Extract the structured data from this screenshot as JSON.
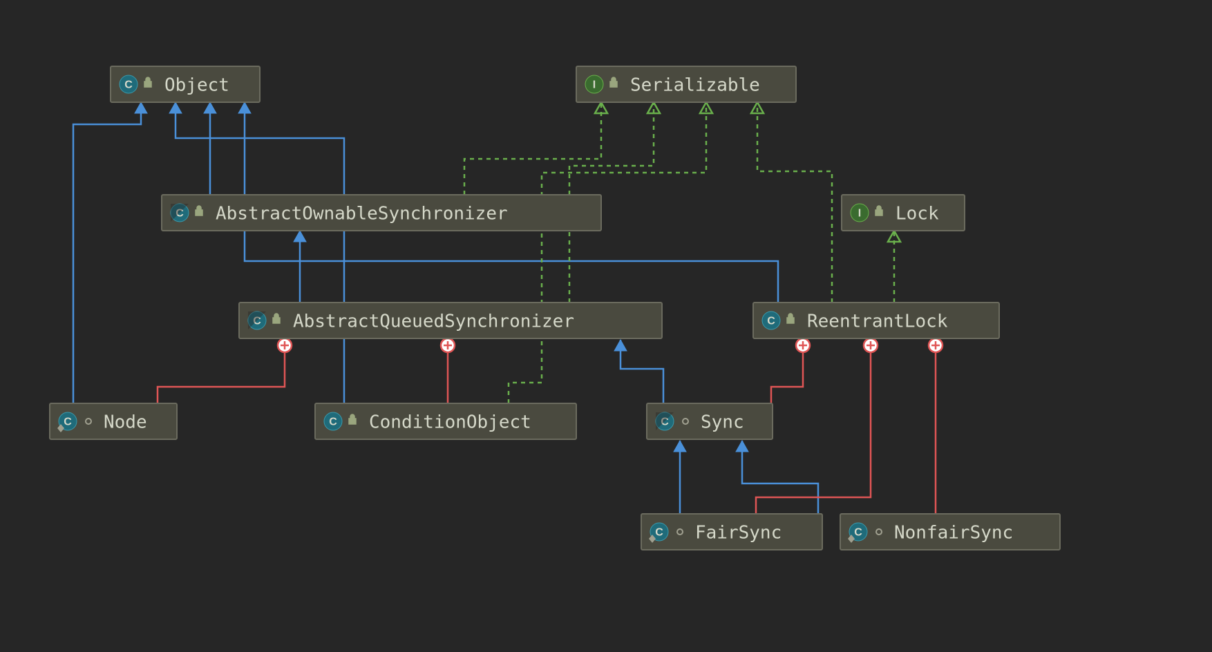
{
  "diagram_type": "uml-class-hierarchy",
  "colors": {
    "background": "#262626",
    "node_fill": "#4a4a3f",
    "node_stroke": "#6b6b5e",
    "text": "#d5d8c9",
    "extends": "#4a90d9",
    "implements": "#6ab04c",
    "inner_class": "#e05555"
  },
  "nodes": {
    "object": {
      "label": "Object",
      "kind": "class",
      "visibility": "public",
      "final": false,
      "abstract": false
    },
    "serializable": {
      "label": "Serializable",
      "kind": "interface",
      "visibility": "public",
      "final": false,
      "abstract": false
    },
    "lock": {
      "label": "Lock",
      "kind": "interface",
      "visibility": "public",
      "final": false,
      "abstract": false
    },
    "aos": {
      "label": "AbstractOwnableSynchronizer",
      "kind": "class",
      "visibility": "public",
      "final": false,
      "abstract": true
    },
    "aqs": {
      "label": "AbstractQueuedSynchronizer",
      "kind": "class",
      "visibility": "public",
      "final": false,
      "abstract": true
    },
    "reentrantlock": {
      "label": "ReentrantLock",
      "kind": "class",
      "visibility": "public",
      "final": false,
      "abstract": false
    },
    "node": {
      "label": "Node",
      "kind": "class",
      "visibility": "package",
      "final": true,
      "abstract": false
    },
    "conditionobject": {
      "label": "ConditionObject",
      "kind": "class",
      "visibility": "public",
      "final": false,
      "abstract": false
    },
    "sync": {
      "label": "Sync",
      "kind": "class",
      "visibility": "package",
      "final": false,
      "abstract": true
    },
    "fairsync": {
      "label": "FairSync",
      "kind": "class",
      "visibility": "package",
      "final": true,
      "abstract": false
    },
    "nonfairsync": {
      "label": "NonfairSync",
      "kind": "class",
      "visibility": "package",
      "final": true,
      "abstract": false
    }
  },
  "edges": [
    {
      "from": "aos",
      "to": "object",
      "type": "extends"
    },
    {
      "from": "aos",
      "to": "serializable",
      "type": "implements"
    },
    {
      "from": "aqs",
      "to": "aos",
      "type": "extends"
    },
    {
      "from": "aqs",
      "to": "serializable",
      "type": "implements"
    },
    {
      "from": "reentrantlock",
      "to": "object",
      "type": "extends"
    },
    {
      "from": "reentrantlock",
      "to": "serializable",
      "type": "implements"
    },
    {
      "from": "reentrantlock",
      "to": "lock",
      "type": "implements"
    },
    {
      "from": "node",
      "to": "object",
      "type": "extends"
    },
    {
      "from": "node",
      "to": "aqs",
      "type": "inner"
    },
    {
      "from": "conditionobject",
      "to": "object",
      "type": "extends"
    },
    {
      "from": "conditionobject",
      "to": "serializable",
      "type": "implements"
    },
    {
      "from": "conditionobject",
      "to": "aqs",
      "type": "inner"
    },
    {
      "from": "sync",
      "to": "aqs",
      "type": "extends"
    },
    {
      "from": "sync",
      "to": "reentrantlock",
      "type": "inner"
    },
    {
      "from": "fairsync",
      "to": "sync",
      "type": "extends"
    },
    {
      "from": "fairsync",
      "to": "reentrantlock",
      "type": "inner"
    },
    {
      "from": "nonfairsync",
      "to": "sync",
      "type": "extends"
    },
    {
      "from": "nonfairsync",
      "to": "reentrantlock",
      "type": "inner"
    }
  ]
}
